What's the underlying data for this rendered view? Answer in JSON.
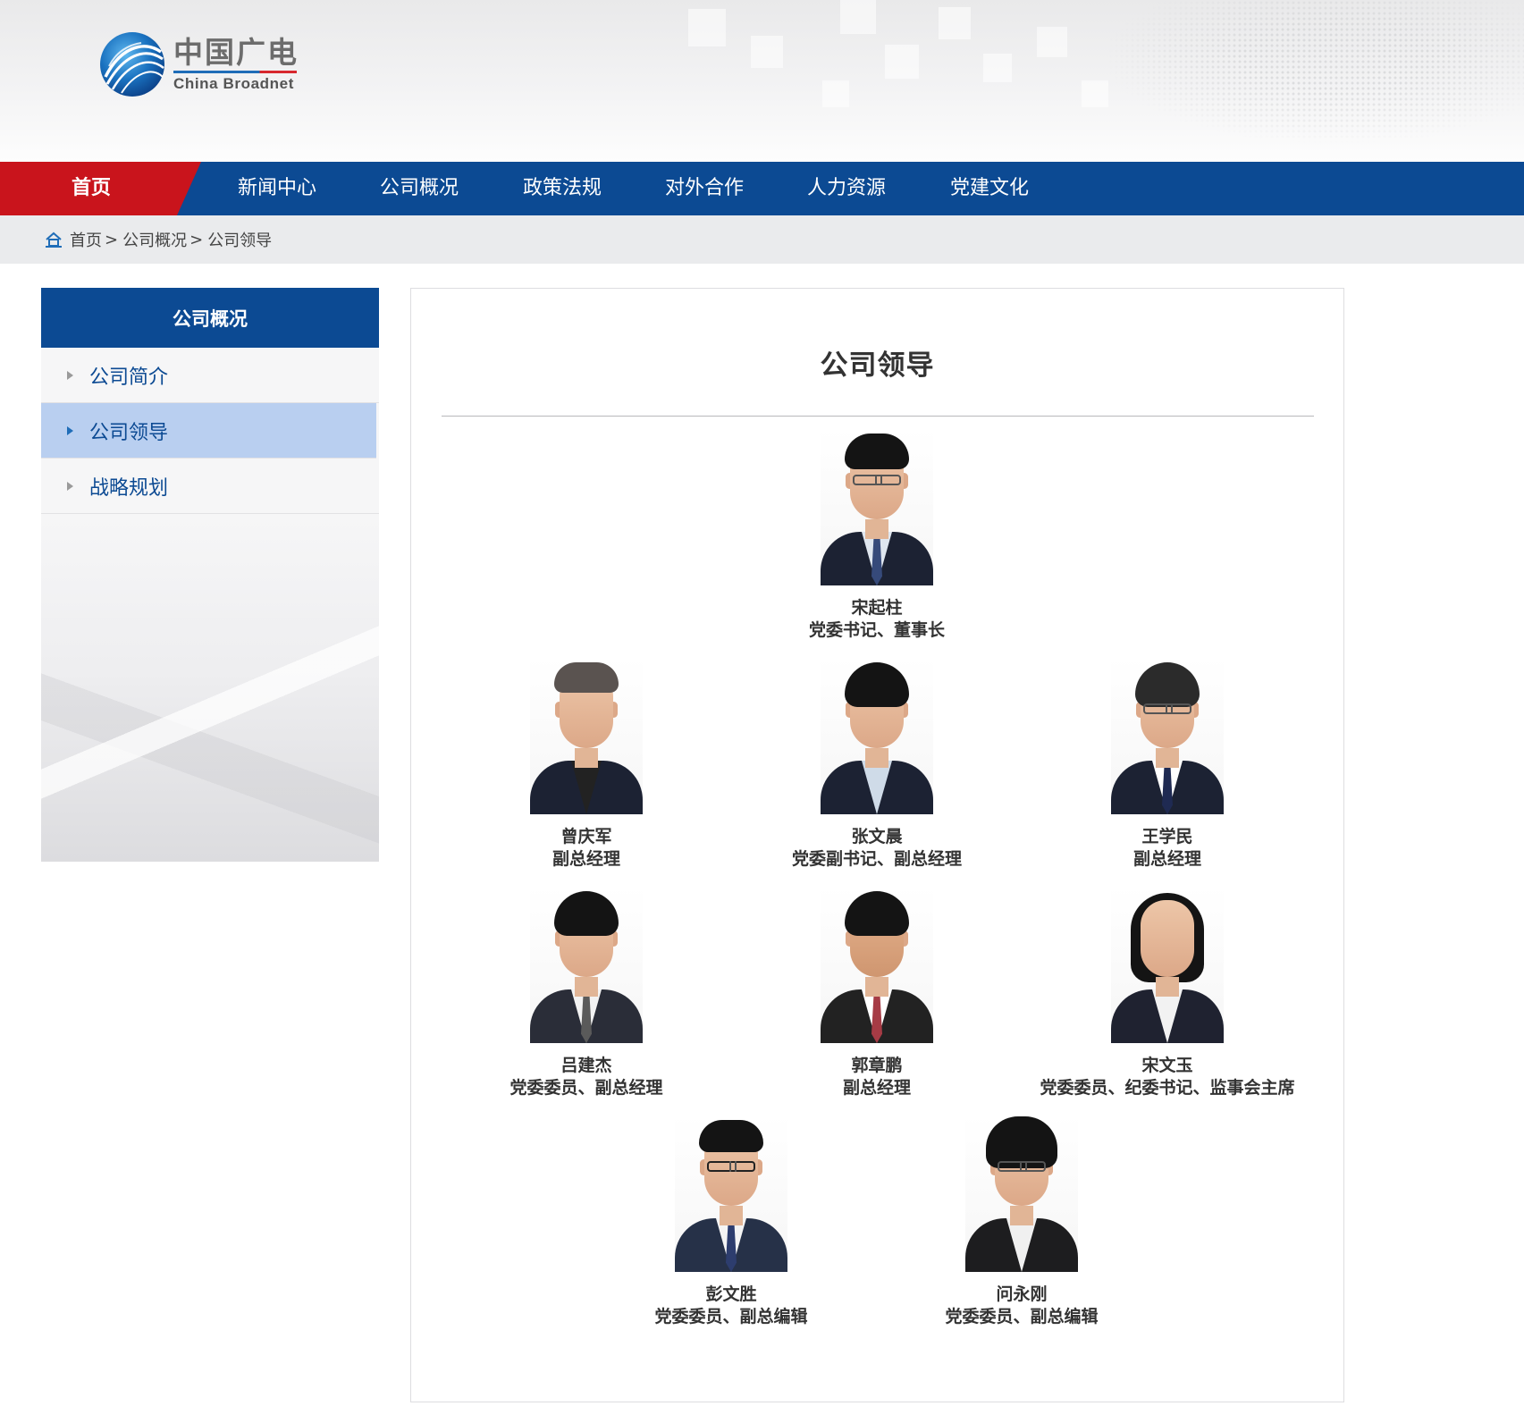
{
  "header": {
    "logo_cn": "中国广电",
    "logo_en": "China Broadnet"
  },
  "nav": {
    "items": [
      {
        "label": "首页",
        "active": true
      },
      {
        "label": "新闻中心"
      },
      {
        "label": "公司概况"
      },
      {
        "label": "政策法规"
      },
      {
        "label": "对外合作"
      },
      {
        "label": "人力资源"
      },
      {
        "label": "党建文化"
      }
    ]
  },
  "breadcrumb": {
    "items": [
      "首页",
      "公司概况",
      "公司领导"
    ],
    "separator": ">"
  },
  "sidebar": {
    "title": "公司概况",
    "items": [
      {
        "label": "公司简介"
      },
      {
        "label": "公司领导",
        "active": true
      },
      {
        "label": "战略规划"
      }
    ]
  },
  "main": {
    "title": "公司领导",
    "leaders": [
      {
        "name": "宋起柱",
        "title": "党委书记、董事长"
      },
      {
        "name": "曾庆军",
        "title": "副总经理"
      },
      {
        "name": "张文晨",
        "title": "党委副书记、副总经理"
      },
      {
        "name": "王学民",
        "title": "副总经理"
      },
      {
        "name": "吕建杰",
        "title": "党委委员、副总经理"
      },
      {
        "name": "郭章鹏",
        "title": "副总经理"
      },
      {
        "name": "宋文玉",
        "title": "党委委员、纪委书记、监事会主席"
      },
      {
        "name": "彭文胜",
        "title": "党委委员、副总编辑"
      },
      {
        "name": "问永刚",
        "title": "党委委员、副总编辑"
      }
    ]
  },
  "colors": {
    "nav_blue": "#0c4a93",
    "home_red": "#c9141c",
    "active_sidebar": "#b9cff0"
  }
}
